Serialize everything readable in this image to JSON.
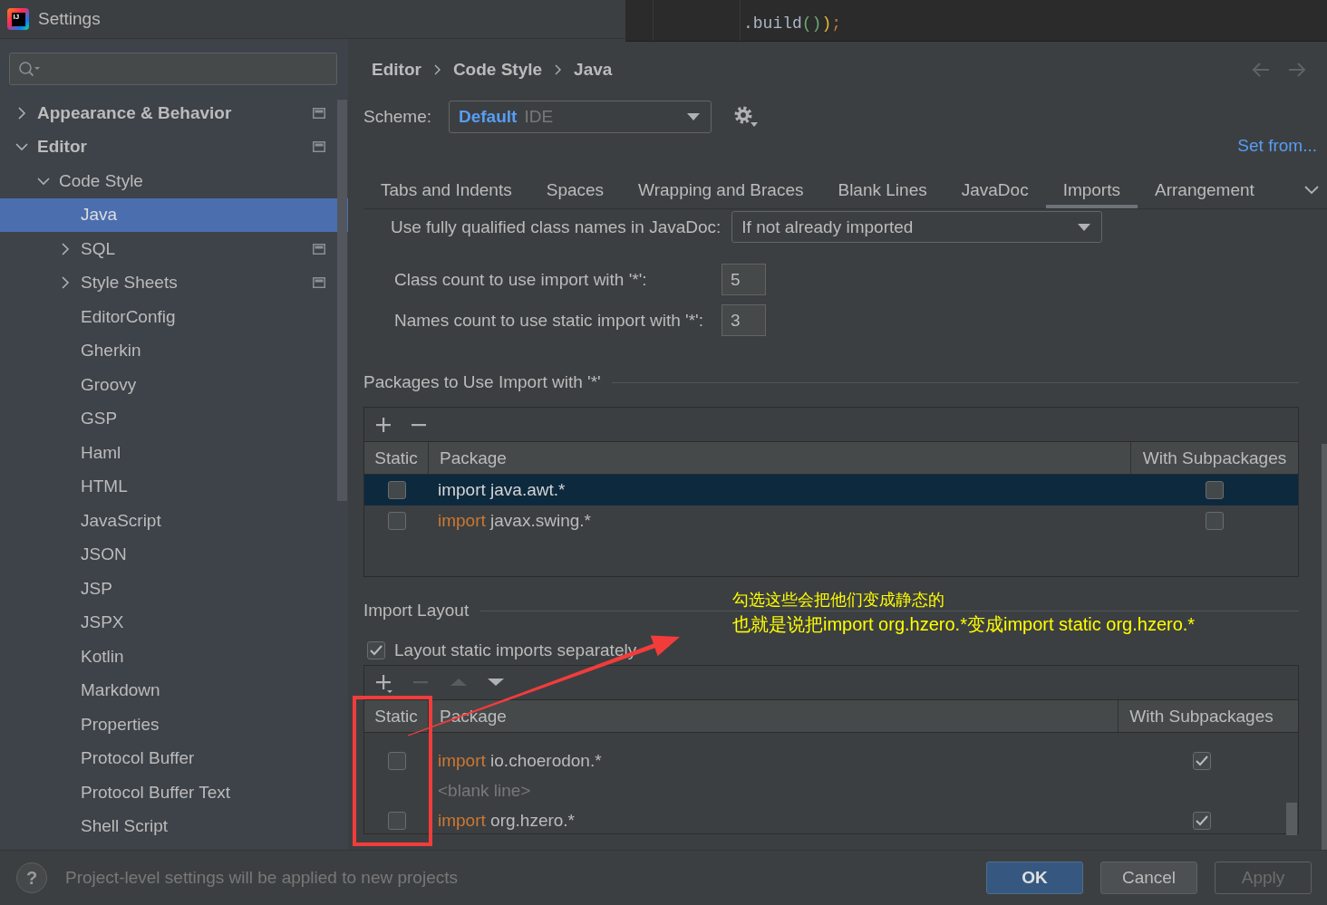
{
  "window": {
    "title": "Settings",
    "logo_text": "IJ"
  },
  "code_overlay": {
    "tokens": [
      {
        "text": ".build",
        "color": "#a9b7c6"
      },
      {
        "text": "()",
        "color": "#6aab73"
      },
      {
        "text": ")",
        "color": "#e8ba36"
      },
      {
        "text": ";",
        "color": "#cc7832"
      }
    ]
  },
  "sidebar": {
    "items": [
      {
        "label": "Appearance & Behavior",
        "expanded": false,
        "project_level": true,
        "selected": false
      },
      {
        "label": "Editor",
        "expanded": true,
        "project_level": true,
        "selected": false,
        "children": [
          {
            "label": "Code Style",
            "expanded": true,
            "project_level": false,
            "selected": false,
            "children": [
              {
                "label": "Java",
                "project_level": false,
                "selected": true
              },
              {
                "label": "SQL",
                "expanded": false,
                "project_level": true,
                "selected": false
              },
              {
                "label": "Style Sheets",
                "expanded": false,
                "project_level": true,
                "selected": false
              },
              {
                "label": "EditorConfig",
                "project_level": false,
                "selected": false
              },
              {
                "label": "Gherkin",
                "project_level": false,
                "selected": false
              },
              {
                "label": "Groovy",
                "project_level": false,
                "selected": false
              },
              {
                "label": "GSP",
                "project_level": false,
                "selected": false
              },
              {
                "label": "Haml",
                "project_level": false,
                "selected": false
              },
              {
                "label": "HTML",
                "project_level": false,
                "selected": false
              },
              {
                "label": "JavaScript",
                "project_level": false,
                "selected": false
              },
              {
                "label": "JSON",
                "project_level": false,
                "selected": false
              },
              {
                "label": "JSP",
                "project_level": false,
                "selected": false
              },
              {
                "label": "JSPX",
                "project_level": false,
                "selected": false
              },
              {
                "label": "Kotlin",
                "project_level": false,
                "selected": false
              },
              {
                "label": "Markdown",
                "project_level": false,
                "selected": false
              },
              {
                "label": "Properties",
                "project_level": false,
                "selected": false
              },
              {
                "label": "Protocol Buffer",
                "project_level": false,
                "selected": false
              },
              {
                "label": "Protocol Buffer Text",
                "project_level": false,
                "selected": false
              },
              {
                "label": "Shell Script",
                "project_level": false,
                "selected": false
              }
            ]
          }
        ]
      }
    ]
  },
  "breadcrumb": [
    "Editor",
    "Code Style",
    "Java"
  ],
  "navigation": [
    {
      "kind": "back",
      "disabled": true
    },
    {
      "kind": "forward",
      "disabled": true
    }
  ],
  "scheme": {
    "label": "Scheme:",
    "value": "Default",
    "suffix": "IDE"
  },
  "set_from_link": "Set from...",
  "tabs": [
    {
      "label": "Tabs and Indents",
      "selected": false
    },
    {
      "label": "Spaces",
      "selected": false
    },
    {
      "label": "Wrapping and Braces",
      "selected": false
    },
    {
      "label": "Blank Lines",
      "selected": false
    },
    {
      "label": "JavaDoc",
      "selected": false
    },
    {
      "label": "Imports",
      "selected": true
    },
    {
      "label": "Arrangement",
      "selected": false
    }
  ],
  "javadoc": {
    "label": "Use fully qualified class names in JavaDoc:",
    "value": "If not already imported"
  },
  "counts": [
    {
      "label": "Class count to use import with '*':",
      "value": "5"
    },
    {
      "label": "Names count to use static import with '*':",
      "value": "3"
    }
  ],
  "packages_table": {
    "title": "Packages to Use Import with '*'",
    "toolbar": [
      {
        "kind": "add",
        "disabled": false
      },
      {
        "kind": "remove",
        "disabled": false
      }
    ],
    "columns": [
      "Static",
      "Package",
      "With Subpackages"
    ],
    "rows": [
      {
        "static": false,
        "keyword": "import",
        "package": "java.awt.*",
        "with_subpackages": false,
        "selected": true
      },
      {
        "static": false,
        "keyword": "import",
        "package": "javax.swing.*",
        "with_subpackages": false,
        "selected": false
      }
    ]
  },
  "import_layout": {
    "title": "Import Layout",
    "separate_static": {
      "label": "Layout static imports separately",
      "checked": true
    },
    "toolbar": [
      {
        "kind": "add_menu",
        "disabled": false
      },
      {
        "kind": "remove",
        "disabled": true
      },
      {
        "kind": "up",
        "disabled": true
      },
      {
        "kind": "down",
        "disabled": false
      }
    ],
    "columns": [
      "Static",
      "Package",
      "With Subpackages"
    ],
    "rows": [
      {
        "kind": "package",
        "static": false,
        "keyword": "import",
        "package": "io.choerodon.*",
        "with_subpackages": true
      },
      {
        "kind": "blank",
        "text": "<blank line>"
      },
      {
        "kind": "package",
        "static": false,
        "keyword": "import",
        "package": "org.hzero.*",
        "with_subpackages": true
      }
    ]
  },
  "footer": {
    "help": "?",
    "hint": "Project-level settings will be applied to new projects",
    "buttons": [
      {
        "label": "OK",
        "kind": "primary",
        "disabled": false
      },
      {
        "label": "Cancel",
        "kind": "normal",
        "disabled": false
      },
      {
        "label": "Apply",
        "kind": "normal",
        "disabled": true
      }
    ]
  },
  "annotation": {
    "lines": [
      "勾选这些会把他们变成静态的",
      "也就是说把import org.hzero.*变成import static org.hzero.*"
    ]
  }
}
